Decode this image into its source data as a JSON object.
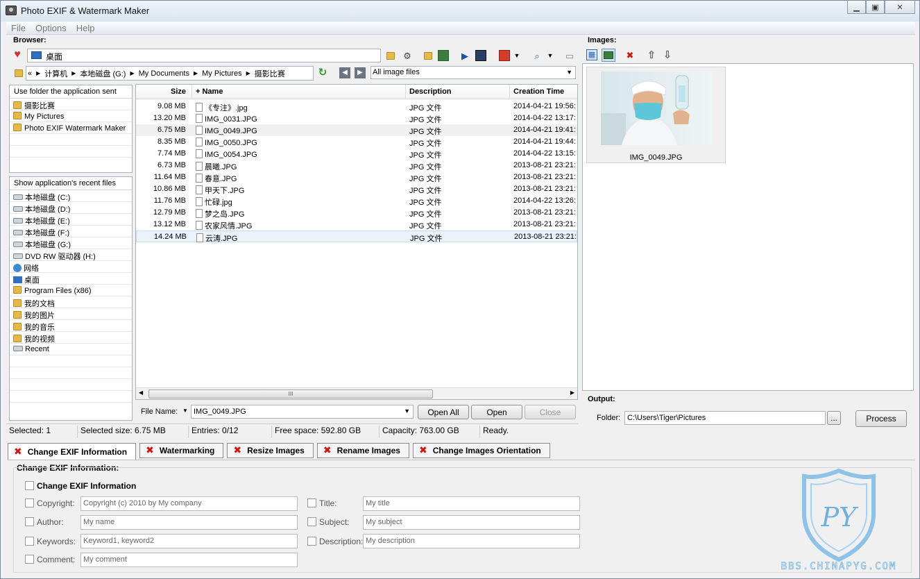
{
  "window": {
    "title": "Photo EXIF & Watermark Maker"
  },
  "menu": [
    "File",
    "Options",
    "Help"
  ],
  "browser": {
    "label": "Browser:",
    "location": "桌面",
    "breadcrumb": [
      "«",
      "计算机",
      "本地磁盘 (G:)",
      "My Documents",
      "My Pictures",
      "摄影比赛"
    ],
    "filter": "All image files"
  },
  "folders_panel": {
    "header": "Use folder the application sent",
    "items": [
      "摄影比赛",
      "My Pictures",
      "Photo EXIF Watermark Maker"
    ]
  },
  "recent_panel": {
    "header": "Show application's recent files",
    "items": [
      "本地磁盘 (C:)",
      "本地磁盘 (D:)",
      "本地磁盘 (E:)",
      "本地磁盘 (F:)",
      "本地磁盘 (G:)",
      "DVD RW 驱动器 (H:)",
      "网络",
      "桌面",
      "Program Files (x86)",
      "我的文档",
      "我的图片",
      "我的音乐",
      "我的视频",
      "Recent"
    ]
  },
  "file_list": {
    "columns": {
      "size": "Size",
      "name": "+ Name",
      "description": "Description",
      "creation_time": "Creation Time"
    },
    "rows": [
      {
        "size": "9.08 MB",
        "name": "《专注》.jpg",
        "description": "JPG 文件",
        "time": "2014-04-21 19:56:"
      },
      {
        "size": "13.20 MB",
        "name": "IMG_0031.JPG",
        "description": "JPG 文件",
        "time": "2014-04-22 13:17:"
      },
      {
        "size": "6.75 MB",
        "name": "IMG_0049.JPG",
        "description": "JPG 文件",
        "time": "2014-04-21 19:41:"
      },
      {
        "size": "8.35 MB",
        "name": "IMG_0050.JPG",
        "description": "JPG 文件",
        "time": "2014-04-21 19:44:"
      },
      {
        "size": "7.74 MB",
        "name": "IMG_0054.JPG",
        "description": "JPG 文件",
        "time": "2014-04-22 13:15:"
      },
      {
        "size": "6.73 MB",
        "name": "晨曦.JPG",
        "description": "JPG 文件",
        "time": "2013-08-21 23:21:"
      },
      {
        "size": "11.64 MB",
        "name": "春意.JPG",
        "description": "JPG 文件",
        "time": "2013-08-21 23:21:"
      },
      {
        "size": "10.86 MB",
        "name": "甲天下.JPG",
        "description": "JPG 文件",
        "time": "2013-08-21 23:21:"
      },
      {
        "size": "11.76 MB",
        "name": "忙碌.jpg",
        "description": "JPG 文件",
        "time": "2014-04-22 13:26:"
      },
      {
        "size": "12.79 MB",
        "name": "梦之岛.JPG",
        "description": "JPG 文件",
        "time": "2013-08-21 23:21:"
      },
      {
        "size": "13.12 MB",
        "name": "农家风情.JPG",
        "description": "JPG 文件",
        "time": "2013-08-21 23:21:"
      },
      {
        "size": "14.24 MB",
        "name": "云涛.JPG",
        "description": "JPG 文件",
        "time": "2013-08-21 23:21:"
      }
    ],
    "scroll_grip": "III"
  },
  "file_name_bar": {
    "label": "File Name:",
    "value": "IMG_0049.JPG",
    "open_all": "Open All",
    "open": "Open",
    "close": "Close"
  },
  "status": {
    "selected": "Selected: 1",
    "selected_size": "Selected size: 6.75 MB",
    "entries": "Entries: 0/12",
    "free_space": "Free space: 592.80 GB",
    "capacity": "Capacity: 763.00 GB",
    "state": "Ready."
  },
  "images": {
    "label": "Images:",
    "thumbnail_caption": "IMG_0049.JPG"
  },
  "output": {
    "label": "Output:",
    "folder_label": "Folder:",
    "folder_value": "C:\\Users\\Tiger\\Pictures",
    "browse": "...",
    "process": "Process"
  },
  "tabs": [
    "Change EXIF Information",
    "Watermarking",
    "Resize Images",
    "Rename Images",
    "Change Images Orientation"
  ],
  "exif": {
    "section_title": "Change EXIF Information:",
    "enable_label": "Change EXIF Information",
    "copyright_label": "Copyright:",
    "copyright_value": "Copyright (c) 2010 by My company",
    "author_label": "Author:",
    "author_value": "My name",
    "keywords_label": "Keywords:",
    "keywords_value": "Keyword1, keyword2",
    "comment_label": "Comment:",
    "comment_value": "My comment",
    "title_label": "Title:",
    "title_value": "My title",
    "subject_label": "Subject:",
    "subject_value": "My subject",
    "description_label": "Description:",
    "description_value": "My description"
  },
  "watermark_logo": {
    "text": "BBS.CHINAPYG.COM",
    "letters": "PY"
  },
  "colors": {
    "accent": "#2b63b0",
    "red_x": "#d21414",
    "logo": "#5aa3d8"
  }
}
